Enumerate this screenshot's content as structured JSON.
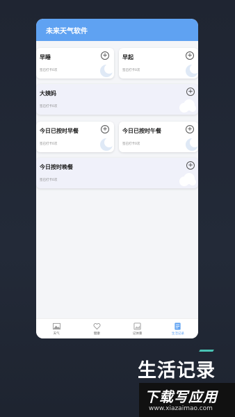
{
  "app": {
    "title": "未来天气软件"
  },
  "cards": [
    {
      "title": "早睡",
      "sub": "签已打卡0次"
    },
    {
      "title": "早起",
      "sub": "签已打卡0次"
    },
    {
      "title": "大姨妈",
      "sub": "签已打卡0次"
    },
    {
      "title": "今日已按时早餐",
      "sub": "签已打卡0次"
    },
    {
      "title": "今日已按时午餐",
      "sub": "签已打卡0次"
    },
    {
      "title": "今日按时晚餐",
      "sub": "签已打卡0次"
    }
  ],
  "plus_symbol": "+",
  "tabs": [
    {
      "label": "天气",
      "icon": "mountain-icon"
    },
    {
      "label": "健康",
      "icon": "heart-icon"
    },
    {
      "label": "记体重",
      "icon": "image-icon"
    },
    {
      "label": "生活记录",
      "icon": "document-icon",
      "active": true
    }
  ],
  "promo": {
    "text": "生活记录"
  },
  "watermark": {
    "main": "下载写应用",
    "url": "www.xiazaimao.com"
  },
  "colors": {
    "appbar": "#5fa2f2",
    "accent": "#5fa2f2",
    "promo_line": "#49c3b4"
  }
}
